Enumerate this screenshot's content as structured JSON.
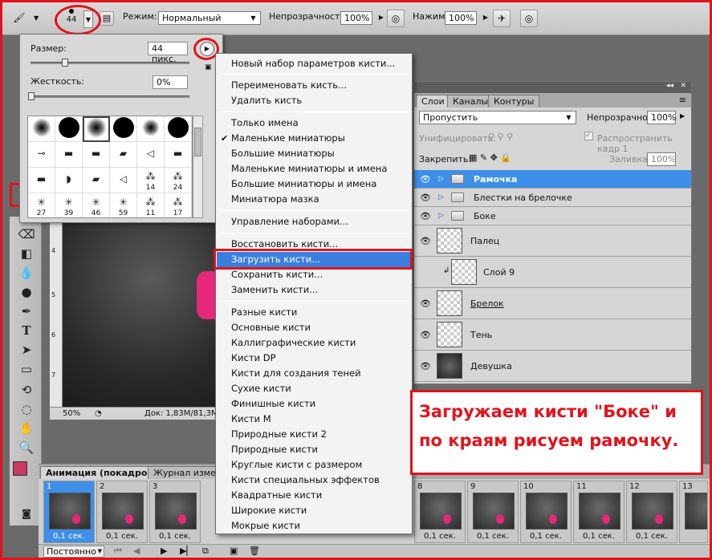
{
  "optbar": {
    "brush_size_preview": "44",
    "mode_label": "Режим:",
    "mode_value": "Нормальный",
    "opacity_label": "Непрозрачность:",
    "opacity_value": "100%",
    "pressure_label": "Нажим:",
    "pressure_value": "100%"
  },
  "brush_panel": {
    "size_label": "Размер:",
    "size_value": "44 пикс.",
    "hardness_label": "Жесткость:",
    "hardness_value": "0%",
    "grid_numbers": [
      "14",
      "24",
      "27",
      "39",
      "46",
      "59",
      "11",
      "17"
    ]
  },
  "menu": {
    "items": [
      "Новый набор параметров кисти...",
      "Переименовать кисть...",
      "Удалить кисть",
      "Только имена",
      "Маленькие миниатюры",
      "Большие миниатюры",
      "Маленькие миниатюры и имена",
      "Большие миниатюры и имена",
      "Миниатюра мазка",
      "Управление наборами...",
      "Восстановить кисти...",
      "Загрузить кисти...",
      "Сохранить кисти...",
      "Заменить кисти...",
      "Разные кисти",
      "Основные кисти",
      "Каллиграфические кисти",
      "Кисти DP",
      "Кисти для создания теней",
      "Сухие кисти",
      "Финишные кисти",
      "Кисти М",
      "Природные кисти 2",
      "Природные кисти",
      "Круглые кисти с размером",
      "Кисти специальных эффектов",
      "Квадратные кисти",
      "Широкие кисти",
      "Мокрые кисти"
    ]
  },
  "document": {
    "zoom": "50%",
    "doc_info": "Док: 1,83M/81,3M",
    "ruler_marks": [
      "4",
      "5",
      "6",
      "7"
    ]
  },
  "layers": {
    "tabs": [
      "Слои",
      "Каналы",
      "Контуры"
    ],
    "blend_mode": "Пропустить",
    "opacity_label": "Непрозрачность:",
    "opacity_value": "100%",
    "unify_label": "Унифицировать:",
    "propagate_label": "Распространить кадр 1",
    "lock_label": "Закрепить:",
    "fill_label": "Заливка:",
    "fill_value": "100%",
    "rows": [
      {
        "name": "Рамочка",
        "type": "folder"
      },
      {
        "name": "Блестки на брелочке",
        "type": "folder"
      },
      {
        "name": "Боке",
        "type": "folder"
      },
      {
        "name": "Палец",
        "type": "layer"
      },
      {
        "name": "Слой 9",
        "type": "layer"
      },
      {
        "name": "Брелок",
        "type": "layer"
      },
      {
        "name": "Тень",
        "type": "layer"
      },
      {
        "name": "Девушка",
        "type": "layer"
      }
    ]
  },
  "annotation": {
    "text": "Загружаем кисти \"Боке\" и по краям рисуем рамочку."
  },
  "animation": {
    "tabs": [
      "Анимация (покадровая)",
      "Журнал измер"
    ],
    "frame_delay": "0,1 сек.",
    "loop": "Постоянно",
    "frames_left": [
      "1",
      "2",
      "3"
    ],
    "frames_right": [
      "8",
      "9",
      "10",
      "11",
      "12",
      "13"
    ]
  }
}
